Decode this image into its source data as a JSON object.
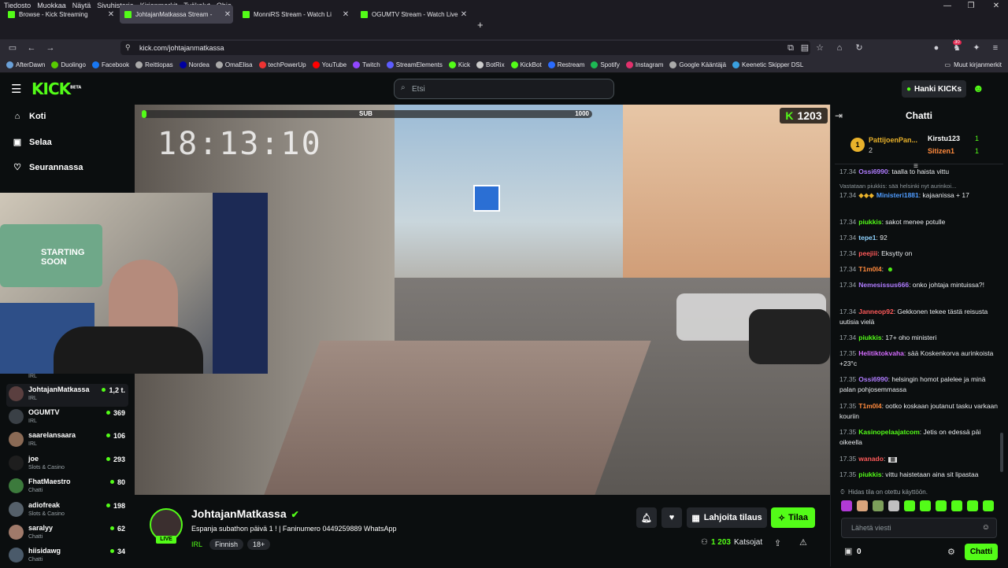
{
  "menubar": {
    "items": [
      "Tiedosto",
      "Muokkaa",
      "Näytä",
      "Sivuhistoria",
      "Kirjanmerkit",
      "Työkalut",
      "Ohje"
    ]
  },
  "tabs": [
    {
      "label": "Browse - Kick Streaming"
    },
    {
      "label": "JohtajanMatkassa Stream -"
    },
    {
      "label": "MonniRS Stream - Watch Li"
    },
    {
      "label": "OGUMTV Stream - Watch Live o"
    }
  ],
  "url": "kick.com/johtajanmatkassa",
  "ext_badge": "30",
  "bookmarks": [
    "AfterDawn",
    "Duolingo",
    "Facebook",
    "Reittiopas",
    "Nordea",
    "OmaElisa",
    "techPowerUp",
    "YouTube",
    "Twitch",
    "StreamElements",
    "Kick",
    "BotRix",
    "KickBot",
    "Restream",
    "Spotify",
    "Instagram",
    "Google Kääntäjä",
    "Keenetic Skipper DSL"
  ],
  "bookmarks_other": "Muut kirjanmerkit",
  "kick": {
    "logo": "KICK",
    "logo_beta": "BETA",
    "search_placeholder": "Etsi",
    "hanki": "Hanki KICKs"
  },
  "nav": {
    "home": "Koti",
    "browse": "Selaa",
    "following": "Seurannassa"
  },
  "channels": [
    {
      "name": "",
      "cat": "IRL",
      "viewers": ""
    },
    {
      "name": "JohtajanMatkassa",
      "cat": "IRL",
      "viewers": "1,2 t."
    },
    {
      "name": "OGUMTV",
      "cat": "IRL",
      "viewers": "369"
    },
    {
      "name": "saarelansaara",
      "cat": "IRL",
      "viewers": "106"
    },
    {
      "name": "joe",
      "cat": "Slots & Casino",
      "viewers": "293"
    },
    {
      "name": "FhatMaestro",
      "cat": "Chatti",
      "viewers": "80"
    },
    {
      "name": "adiofreak",
      "cat": "Slots & Casino",
      "viewers": "198"
    },
    {
      "name": "saralyy",
      "cat": "Chatti",
      "viewers": "62"
    },
    {
      "name": "hiisidawg",
      "cat": "Chatti",
      "viewers": "34"
    }
  ],
  "overlay": {
    "sub_label": "SUB",
    "sub_goal": "1000",
    "clock": "18:13:10",
    "k_count": "1203",
    "sign_text": "STARTING SOON"
  },
  "stream": {
    "streamer": "JohtajanMatkassa",
    "live": "LIVE",
    "title": "Espanja subathon päivä 1 ! | Faninumero 0449259889 WhatsApp",
    "category": "IRL",
    "tags": [
      "Finnish",
      "18+"
    ],
    "gift_label": "Lahjoita tilaus",
    "sub_label": "Tilaa",
    "viewers": "1 203",
    "viewers_label": "Katsojat"
  },
  "chat": {
    "header": "Chatti",
    "leaders": [
      {
        "rank": "1",
        "name": "PattijoenPan...",
        "count": "2"
      },
      {
        "name": "Kirstu123",
        "count": "1"
      },
      {
        "name": "Sitizen1",
        "count": "1"
      }
    ],
    "reply_hint": "Vastataan piukkis: sää helsinki nyt aurinkoi...",
    "messages": [
      {
        "t": "17.34",
        "u": "Ossi6990",
        "c": "#b07cff",
        "m": ": taalla to haista vittu"
      },
      {
        "t": "17.34",
        "u": "Ministeri1881",
        "c": "#4f9cff",
        "m": ": kajaanissa + 17"
      },
      {
        "t": "17.34",
        "u": "piukkis",
        "c": "#53fc18",
        "m": ": sakot menee potulle"
      },
      {
        "t": "17.34",
        "u": "tepe1",
        "c": "#8fd3ff",
        "m": ": 92"
      },
      {
        "t": "17.34",
        "u": "peejiii",
        "c": "#ff5a5a",
        "m": ": Eksytty on"
      },
      {
        "t": "17.34",
        "u": "T1m0I4",
        "c": "#ff8a3d",
        "m": ":"
      },
      {
        "t": "17.34",
        "u": "Nemesissus666",
        "c": "#b07cff",
        "m": ": onko johtaja mintuissa?!"
      },
      {
        "t": "17.34",
        "u": "Janneop92",
        "c": "#ff5a5a",
        "m": ": Gekkonen tekee tästä reisusta uutisia vielä"
      },
      {
        "t": "17.34",
        "u": "piukkis",
        "c": "#53fc18",
        "m": ": 17+ oho ministeri"
      },
      {
        "t": "17.35",
        "u": "Helitiktokvaha",
        "c": "#d56cff",
        "m": ": sää Koskenkorva aurinkoista +23°c"
      },
      {
        "t": "17.35",
        "u": "Ossi6990",
        "c": "#b07cff",
        "m": ": helsingin homot palelee ja minä palan pohjosemmassa"
      },
      {
        "t": "17.35",
        "u": "T1m0I4",
        "c": "#ff8a3d",
        "m": ": ootko koskaan joutanut tasku varkaan kouriin"
      },
      {
        "t": "17.35",
        "u": "Kasinopelaajatcom",
        "c": "#53fc18",
        "m": ": Jetis on edessä päi oikeella"
      },
      {
        "t": "17.35",
        "u": "wanado",
        "c": "#ff5a5a",
        "m": ":"
      },
      {
        "t": "17.35",
        "u": "piukkis",
        "c": "#53fc18",
        "m": ": vittu haistetaan aina sit lipastaa"
      }
    ],
    "slow_mode": "Hidas tila on otettu käyttöön.",
    "input_placeholder": "Lähetä viesti",
    "points": "0",
    "send": "Chatti"
  },
  "colors": {
    "accent": "#53fc18",
    "bg": "#0b0e0f",
    "panel": "#24272c"
  }
}
